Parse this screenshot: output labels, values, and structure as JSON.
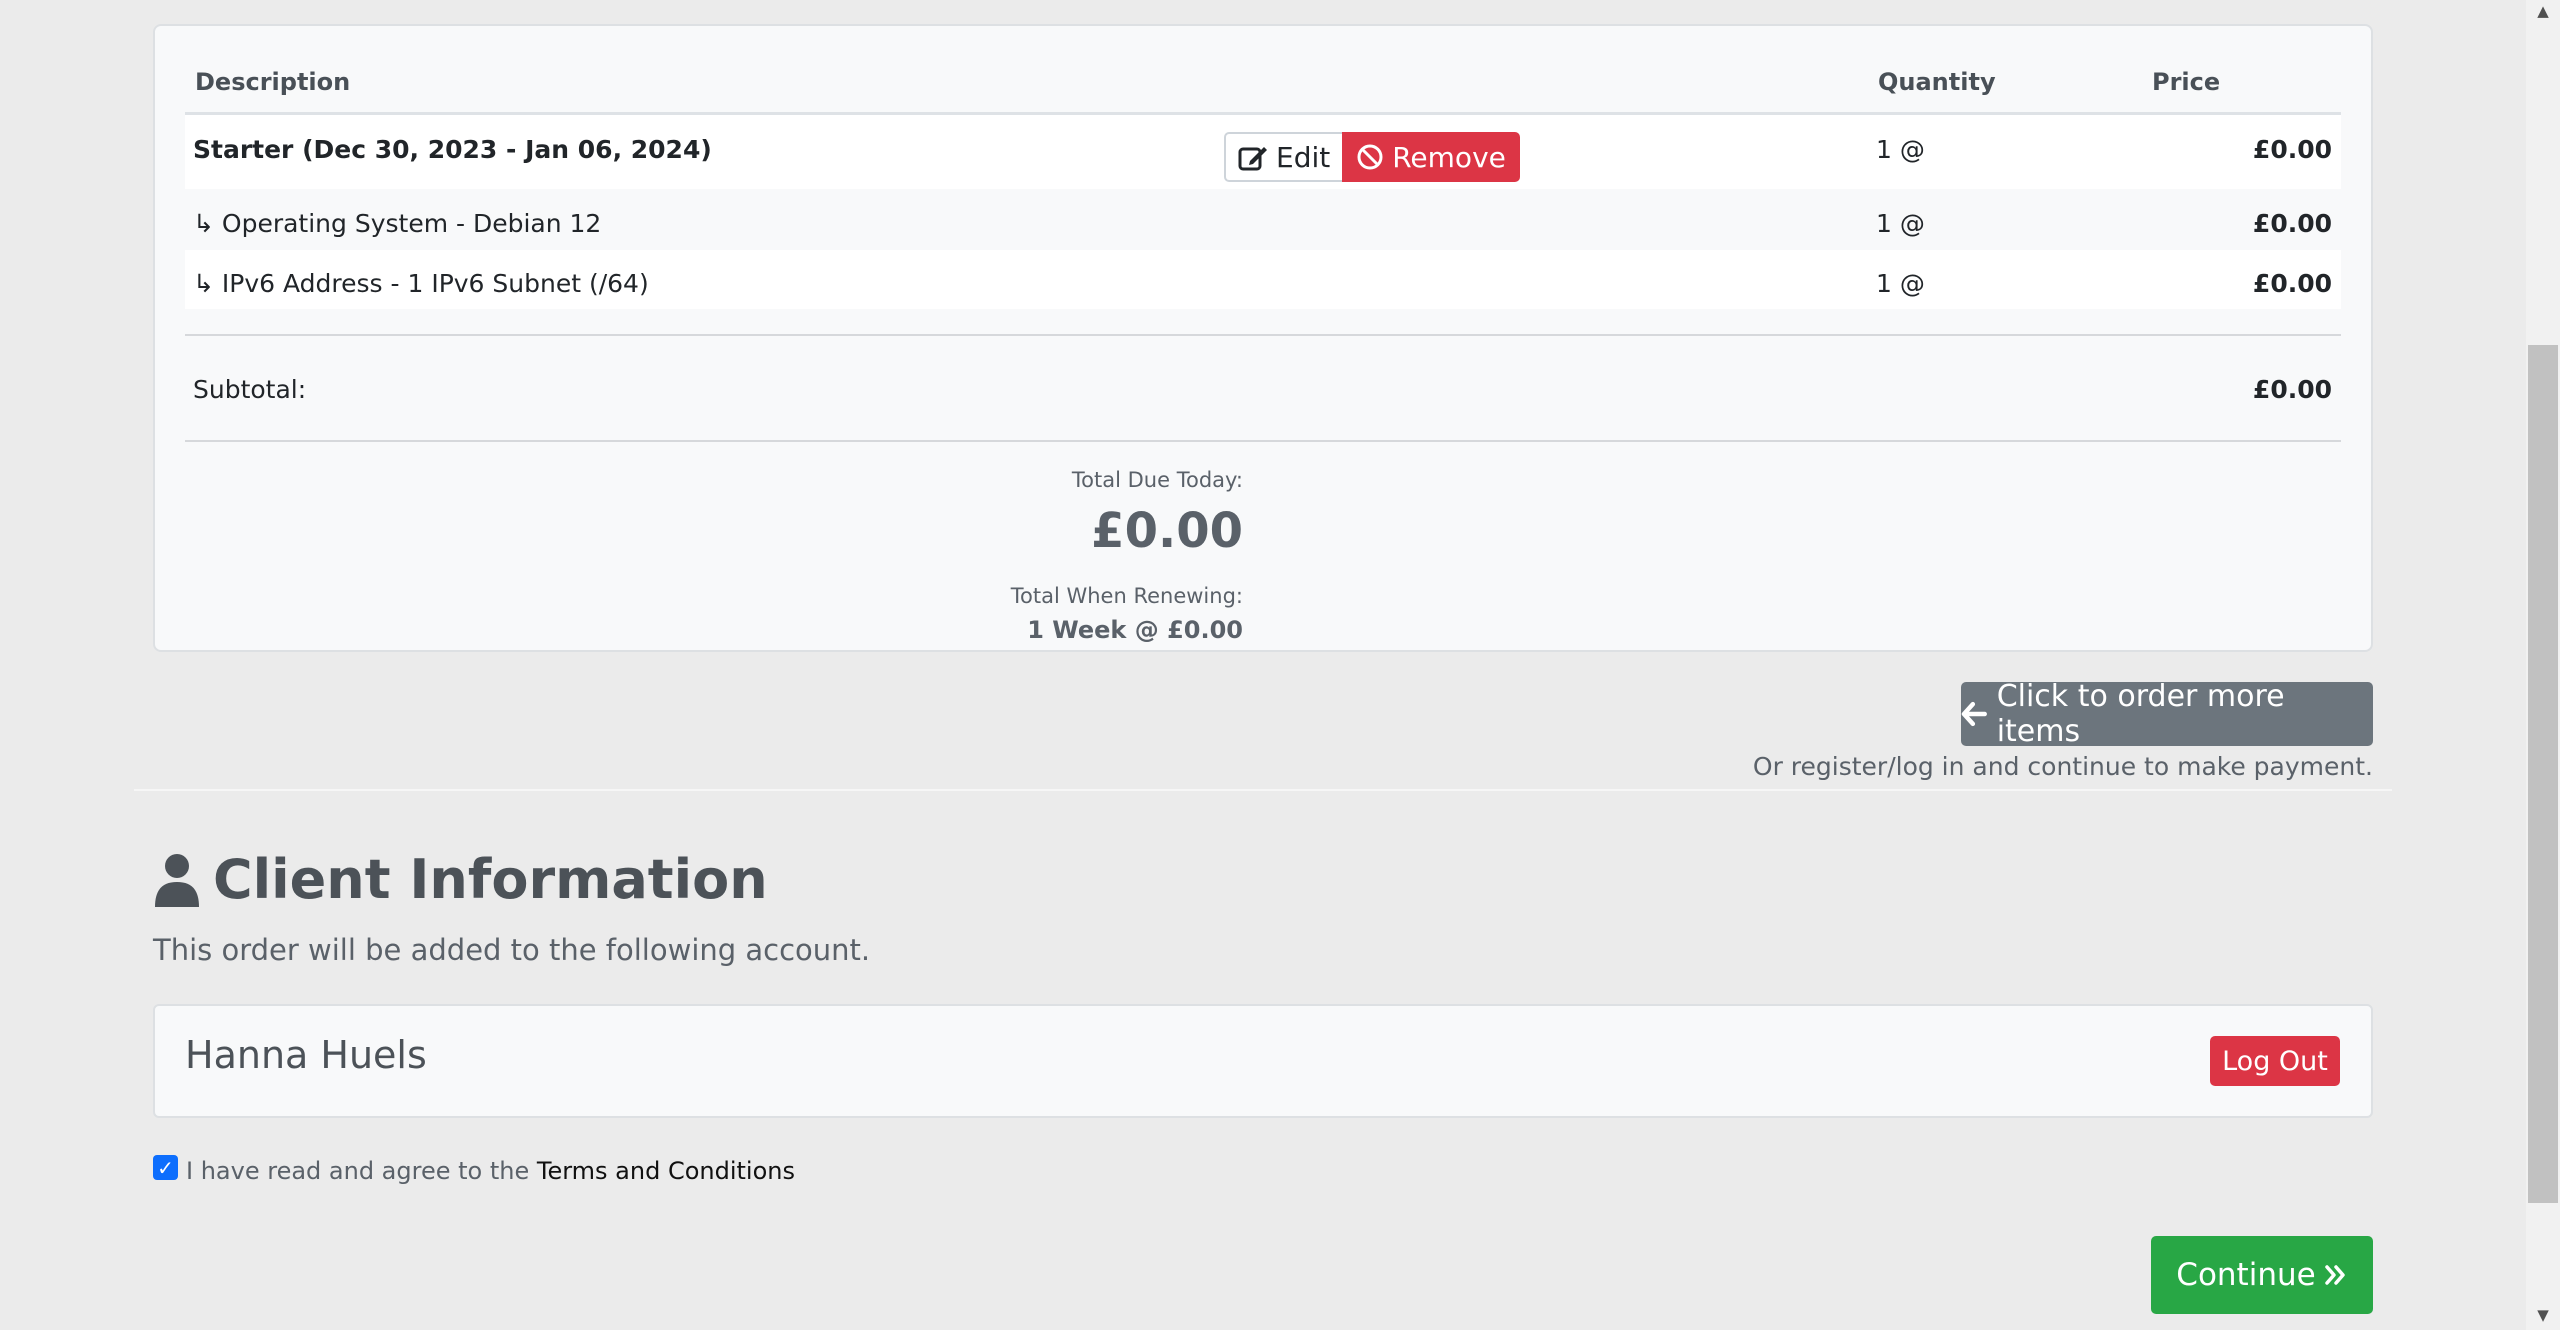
{
  "table": {
    "headers": {
      "description": "Description",
      "quantity": "Quantity",
      "price": "Price"
    },
    "product": {
      "name": "Starter (Dec 30, 2023 - Jan 06, 2024)",
      "quantity": "1 @",
      "price": "£0.00"
    },
    "edit_label": "Edit",
    "remove_label": "Remove",
    "addons": [
      {
        "name": "↳ Operating System - Debian 12",
        "quantity": "1 @",
        "price": "£0.00"
      },
      {
        "name": "↳ IPv6 Address - 1 IPv6 Subnet (/64)",
        "quantity": "1 @",
        "price": "£0.00"
      }
    ],
    "subtotal_label": "Subtotal:",
    "subtotal_value": "£0.00"
  },
  "totals": {
    "due_today_label": "Total Due Today:",
    "due_today_value": "£0.00",
    "renewing_label": "Total When Renewing:",
    "renewing_value": "1 Week @ £0.00"
  },
  "actions": {
    "order_more_label": "Click to order more items",
    "hint": "Or register/log in and continue to make payment.",
    "continue_label": "Continue"
  },
  "client": {
    "title": "Client Information",
    "subtitle": "This order will be added to the following account.",
    "account_name": "Hanna Huels",
    "logout_label": "Log Out"
  },
  "terms": {
    "checked": true,
    "text": "I have read and agree to the",
    "link": "Terms and Conditions"
  },
  "colors": {
    "danger": "#dc3545",
    "secondary": "#6c757d",
    "success": "#28a745",
    "primary": "#0d6efd"
  }
}
